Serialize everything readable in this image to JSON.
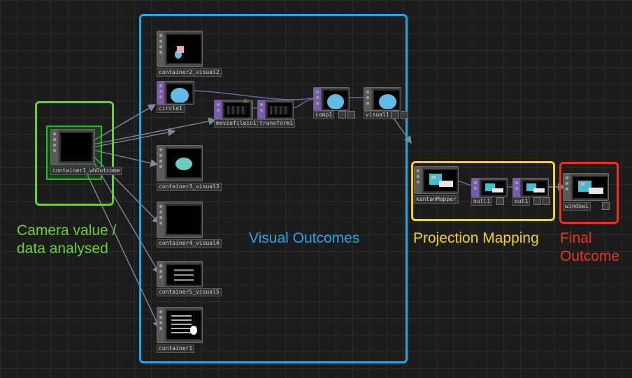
{
  "groups": {
    "camera": {
      "label": "Camera value /\ndata analysed",
      "color": "#6bd02e"
    },
    "visual": {
      "label": "Visual Outcomes",
      "color": "#1fa7ea"
    },
    "projection": {
      "label": "Projection Mapping",
      "color": "#f0d31e"
    },
    "final": {
      "label": "Final\nOutcome",
      "color": "#e8341c"
    }
  },
  "nodes": {
    "container2_visual2": {
      "label": "container2_visual2",
      "thumb": "container"
    },
    "circle1": {
      "label": "circle1",
      "thumb": "circle"
    },
    "moviefilein1": {
      "label": "moviefilein1",
      "thumb": "movie",
      "warning": "⚠"
    },
    "transform1": {
      "label": "transform1",
      "thumb": "movie"
    },
    "comp1": {
      "label": "comp1",
      "thumb": "circle"
    },
    "visual1": {
      "label": "visual1",
      "thumb": "circle"
    },
    "container1_whOutcome": {
      "label": "container1_whOutcome",
      "thumb": "black"
    },
    "container3_visual3": {
      "label": "container3_visual3",
      "thumb": "teal"
    },
    "container4_visual4": {
      "label": "container4_visual4",
      "thumb": "noise"
    },
    "container5_visual5": {
      "label": "container5_visual5",
      "thumb": "bars"
    },
    "container1": {
      "label": "container1",
      "thumb": "text"
    },
    "kantanMapper": {
      "label": "kantanMapper",
      "thumb": "mapper"
    },
    "null1": {
      "label": "null1",
      "thumb": "mapper"
    },
    "out1": {
      "label": "out1",
      "thumb": "mapper"
    },
    "window1": {
      "label": "window1",
      "thumb": "mapper"
    }
  }
}
